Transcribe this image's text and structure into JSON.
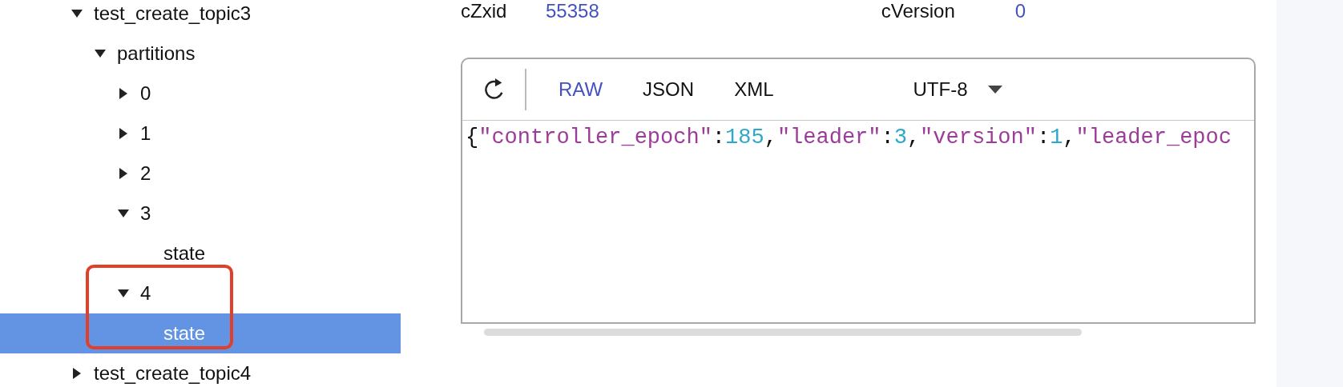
{
  "tree": [
    {
      "label": "test_create_topic3",
      "expanded": true,
      "selected": false,
      "children": [
        {
          "label": "partitions",
          "expanded": true,
          "selected": false,
          "children": [
            {
              "label": "0",
              "expanded": false,
              "selected": false
            },
            {
              "label": "1",
              "expanded": false,
              "selected": false
            },
            {
              "label": "2",
              "expanded": false,
              "selected": false
            },
            {
              "label": "3",
              "expanded": true,
              "selected": false,
              "children": [
                {
                  "label": "state",
                  "selected": false
                }
              ]
            },
            {
              "label": "4",
              "expanded": true,
              "selected": false,
              "annotated": true,
              "children": [
                {
                  "label": "state",
                  "selected": true
                }
              ]
            }
          ]
        }
      ]
    },
    {
      "label": "test_create_topic4",
      "expanded": false,
      "selected": false
    }
  ],
  "stats": [
    {
      "label": "cZxid",
      "value": "55358"
    },
    {
      "label": "cVersion",
      "value": "0"
    }
  ],
  "viewer": {
    "tabs": [
      {
        "label": "RAW",
        "selected": true
      },
      {
        "label": "JSON",
        "selected": false
      },
      {
        "label": "XML",
        "selected": false
      }
    ],
    "encoding": "UTF-8",
    "content": [
      {
        "kind": "punct",
        "text": "{"
      },
      {
        "kind": "key",
        "text": "\"controller_epoch\""
      },
      {
        "kind": "punct",
        "text": ":"
      },
      {
        "kind": "number",
        "text": "185"
      },
      {
        "kind": "punct",
        "text": ","
      },
      {
        "kind": "key",
        "text": "\"leader\""
      },
      {
        "kind": "punct",
        "text": ":"
      },
      {
        "kind": "number",
        "text": "3"
      },
      {
        "kind": "punct",
        "text": ","
      },
      {
        "kind": "key",
        "text": "\"version\""
      },
      {
        "kind": "punct",
        "text": ":"
      },
      {
        "kind": "number",
        "text": "1"
      },
      {
        "kind": "punct",
        "text": ","
      },
      {
        "kind": "key",
        "text": "\"leader_epoc"
      }
    ]
  }
}
